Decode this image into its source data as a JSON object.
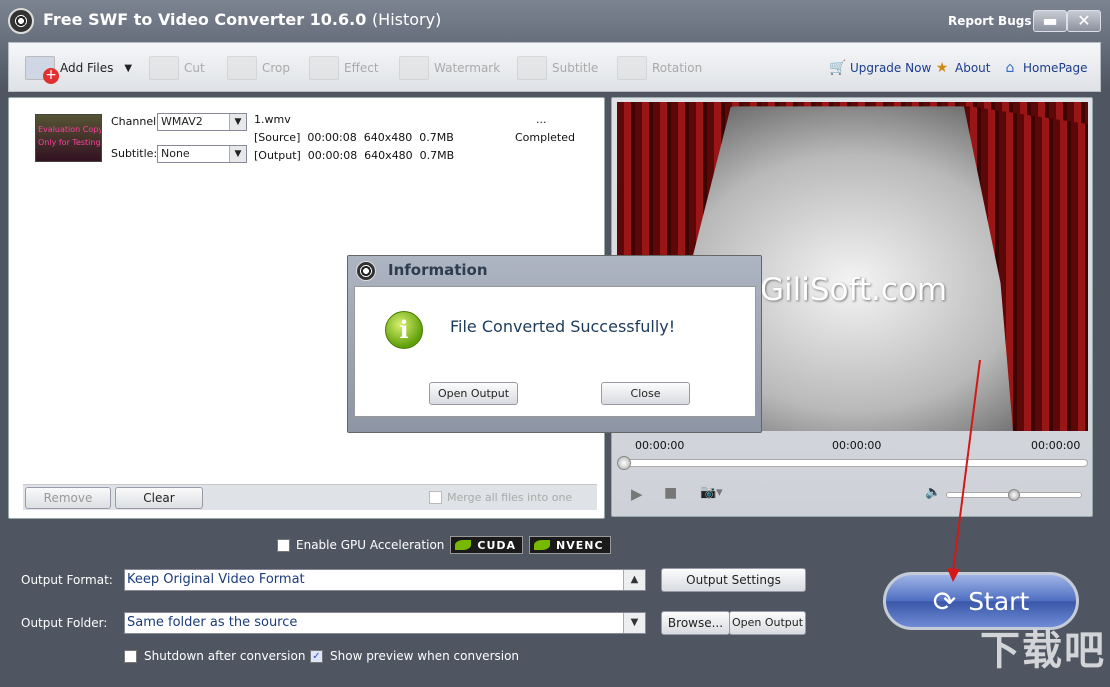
{
  "window": {
    "title": "Free SWF to Video Converter 10.6.0",
    "title_suffix": "(History)",
    "report_bugs": "Report Bugs",
    "minimize": "▬",
    "close": "✕"
  },
  "toolbar": {
    "add_files": "Add Files",
    "cut": "Cut",
    "crop": "Crop",
    "effect": "Effect",
    "watermark": "Watermark",
    "subtitle": "Subtitle",
    "rotation": "Rotation",
    "upgrade": "Upgrade Now",
    "about": "About",
    "homepage": "HomePage"
  },
  "file": {
    "thumb_line1": "Evaluation Copy",
    "thumb_line2": "Only for Testing",
    "channel_label": "Channel:",
    "channel_value": "WMAV2",
    "subtitle_label": "Subtitle:",
    "subtitle_value": "None",
    "name": "1.wmv",
    "source": "[Source]  00:00:08  640x480  0.7MB",
    "output": "[Output]  00:00:08  640x480  0.7MB",
    "dots": "...",
    "status": "Completed"
  },
  "list": {
    "remove": "Remove",
    "clear": "Clear",
    "merge": "Merge all files into one"
  },
  "preview": {
    "watermark": "GiliSoft.com",
    "time_start": "00:00:00",
    "time_mid": "00:00:00",
    "time_end": "00:00:00"
  },
  "gpu": {
    "label": "Enable GPU Acceleration",
    "cuda": "CUDA",
    "nvenc": "NVENC"
  },
  "output": {
    "format_label": "Output Format:",
    "format_value": "Keep Original Video Format",
    "settings": "Output Settings",
    "folder_label": "Output Folder:",
    "folder_value": "Same folder as the source",
    "browse": "Browse...",
    "open_output": "Open Output",
    "shutdown": "Shutdown after conversion",
    "show_preview": "Show preview when conversion",
    "start": "Start"
  },
  "dialog": {
    "title": "Information",
    "message": "File Converted Successfully!",
    "open_output": "Open Output",
    "close": "Close"
  },
  "site_watermark": "下载吧"
}
